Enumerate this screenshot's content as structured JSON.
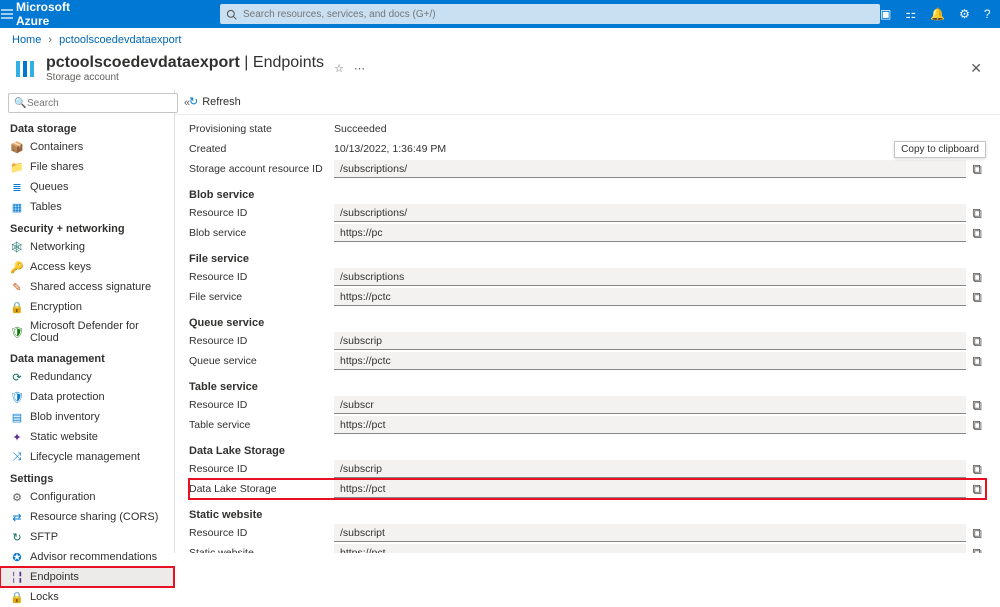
{
  "topbar": {
    "brand": "Microsoft Azure",
    "search_placeholder": "Search resources, services, and docs (G+/)"
  },
  "breadcrumb": {
    "home": "Home",
    "resource": "pctoolscoedevdataexport"
  },
  "header": {
    "name": "pctoolscoedevdataexport",
    "section": "Endpoints",
    "subtitle": "Storage account"
  },
  "sidebar": {
    "search_placeholder": "Search",
    "groups": [
      {
        "title": "Data storage",
        "items": [
          {
            "label": "Containers",
            "icon": "📦",
            "cls": "blue"
          },
          {
            "label": "File shares",
            "icon": "📁",
            "cls": "orange"
          },
          {
            "label": "Queues",
            "icon": "≣",
            "cls": "blue"
          },
          {
            "label": "Tables",
            "icon": "▦",
            "cls": "blue"
          }
        ]
      },
      {
        "title": "Security + networking",
        "items": [
          {
            "label": "Networking",
            "icon": "🕸",
            "cls": "teal"
          },
          {
            "label": "Access keys",
            "icon": "🔑",
            "cls": "orange"
          },
          {
            "label": "Shared access signature",
            "icon": "✎",
            "cls": "orange"
          },
          {
            "label": "Encryption",
            "icon": "🔒",
            "cls": "gray"
          },
          {
            "label": "Microsoft Defender for Cloud",
            "icon": "🛡",
            "cls": "green"
          }
        ]
      },
      {
        "title": "Data management",
        "items": [
          {
            "label": "Redundancy",
            "icon": "⟳",
            "cls": "teal"
          },
          {
            "label": "Data protection",
            "icon": "🛡",
            "cls": "blue"
          },
          {
            "label": "Blob inventory",
            "icon": "▤",
            "cls": "blue"
          },
          {
            "label": "Static website",
            "icon": "✦",
            "cls": "purple"
          },
          {
            "label": "Lifecycle management",
            "icon": "⤨",
            "cls": "blue"
          }
        ]
      },
      {
        "title": "Settings",
        "items": [
          {
            "label": "Configuration",
            "icon": "⚙",
            "cls": "gray"
          },
          {
            "label": "Resource sharing (CORS)",
            "icon": "⇄",
            "cls": "blue"
          },
          {
            "label": "SFTP",
            "icon": "↻",
            "cls": "teal"
          },
          {
            "label": "Advisor recommendations",
            "icon": "✪",
            "cls": "blue"
          },
          {
            "label": "Endpoints",
            "icon": "╎╏",
            "cls": "purple",
            "selected": true,
            "highlight": true
          },
          {
            "label": "Locks",
            "icon": "🔒",
            "cls": "gray"
          }
        ]
      }
    ]
  },
  "commandbar": {
    "refresh": "Refresh"
  },
  "tooltip": "Copy to clipboard",
  "props": {
    "top": [
      {
        "label": "Provisioning state",
        "value": "Succeeded",
        "type": "text"
      },
      {
        "label": "Created",
        "value": "10/13/2022, 1:36:49 PM",
        "type": "text"
      },
      {
        "label": "Storage account resource ID",
        "value": "/subscriptions/",
        "type": "field",
        "tooltip": true
      }
    ],
    "sections": [
      {
        "title": "Blob service",
        "rows": [
          {
            "label": "Resource ID",
            "value": "/subscriptions/"
          },
          {
            "label": "Blob service",
            "value": "https://pc"
          }
        ]
      },
      {
        "title": "File service",
        "rows": [
          {
            "label": "Resource ID",
            "value": "/subscriptions"
          },
          {
            "label": "File service",
            "value": "https://pctc"
          }
        ]
      },
      {
        "title": "Queue service",
        "rows": [
          {
            "label": "Resource ID",
            "value": "/subscrip"
          },
          {
            "label": "Queue service",
            "value": "https://pctc"
          }
        ]
      },
      {
        "title": "Table service",
        "rows": [
          {
            "label": "Resource ID",
            "value": "/subscr"
          },
          {
            "label": "Table service",
            "value": "https://pct"
          }
        ]
      },
      {
        "title": "Data Lake Storage",
        "rows": [
          {
            "label": "Resource ID",
            "value": "/subscrip"
          },
          {
            "label": "Data Lake Storage",
            "value": "https://pct",
            "highlight": true
          }
        ]
      },
      {
        "title": "Static website",
        "rows": [
          {
            "label": "Resource ID",
            "value": "/subscript"
          },
          {
            "label": "Static website",
            "value": "https://pct"
          }
        ]
      }
    ]
  }
}
